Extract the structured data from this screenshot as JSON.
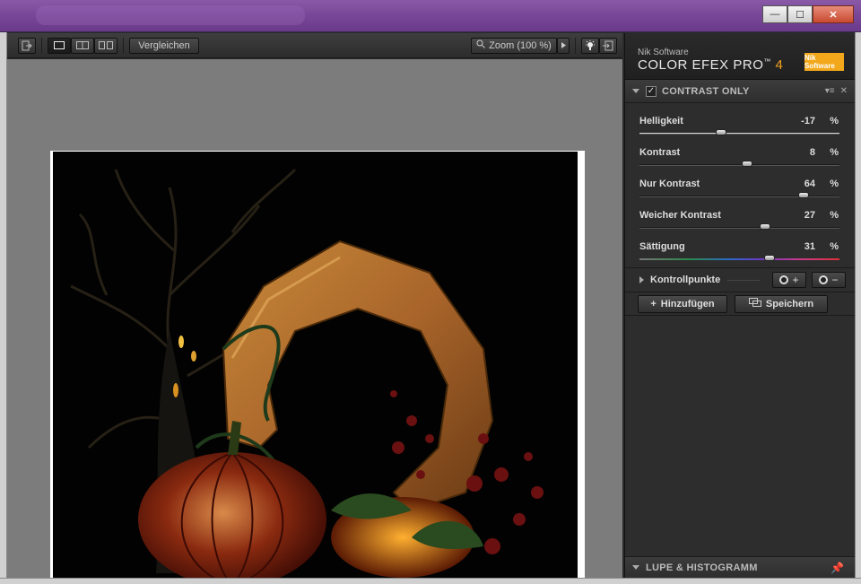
{
  "window": {
    "minimize": "—",
    "maximize": "☐",
    "close": "✕"
  },
  "toolbar": {
    "compare_label": "Vergleichen",
    "zoom_label": "Zoom (100 %)"
  },
  "brand": {
    "vendor": "Nik Software",
    "product": "COLOR EFEX PRO",
    "tm": "™",
    "version": "4",
    "logo_text": "Nik Software"
  },
  "filter": {
    "title": "CONTRAST ONLY",
    "enabled": true,
    "sliders": [
      {
        "label": "Helligkeit",
        "value": "-17",
        "unit": "%",
        "level": 0.41,
        "track": "white"
      },
      {
        "label": "Kontrast",
        "value": "8",
        "unit": "%",
        "level": 0.54,
        "track": "dark"
      },
      {
        "label": "Nur Kontrast",
        "value": "64",
        "unit": "%",
        "level": 0.82,
        "track": "dark"
      },
      {
        "label": "Weicher Kontrast",
        "value": "27",
        "unit": "%",
        "level": 0.63,
        "track": "dark"
      },
      {
        "label": "Sättigung",
        "value": "31",
        "unit": "%",
        "level": 0.65,
        "track": "hue"
      }
    ]
  },
  "control_points": {
    "label": "Kontrollpunkte",
    "add_symbol": "+",
    "remove_symbol": "−"
  },
  "actions": {
    "add_label": "Hinzufügen",
    "save_label": "Speichern"
  },
  "loupe": {
    "title": "LUPE & HISTOGRAMM"
  }
}
